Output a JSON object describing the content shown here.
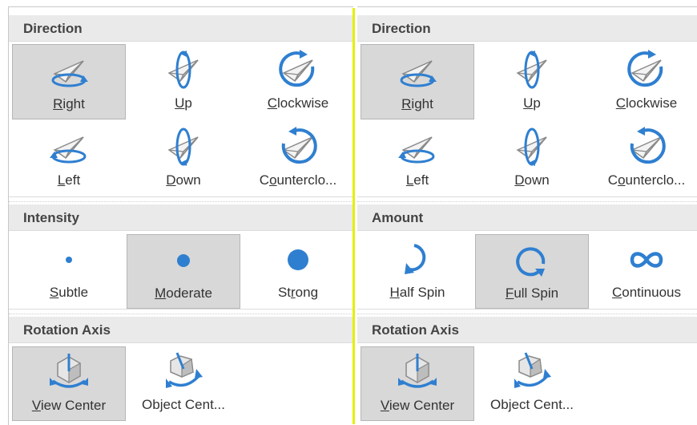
{
  "colors": {
    "icon_blue": "#2f7fd0",
    "icon_gray": "#8a8a8a",
    "divider": "#e6f000"
  },
  "left_panel": {
    "direction": {
      "header": "Direction",
      "items": [
        {
          "label": "Right",
          "mnemonic": "R",
          "rest": "ight",
          "icon": "plane-orbit-right-icon",
          "selected": true
        },
        {
          "label": "Up",
          "mnemonic": "U",
          "rest": "p",
          "icon": "plane-orbit-up-icon",
          "selected": false
        },
        {
          "label": "Clockwise",
          "mnemonic": "C",
          "rest": "lockwise",
          "icon": "plane-clockwise-icon",
          "selected": false
        },
        {
          "label": "Left",
          "mnemonic": "L",
          "rest": "eft",
          "icon": "plane-orbit-left-icon",
          "selected": false
        },
        {
          "label": "Down",
          "mnemonic": "D",
          "rest": "own",
          "icon": "plane-orbit-down-icon",
          "selected": false
        },
        {
          "label": "Counterclo...",
          "mnemonic": "o",
          "pre": "C",
          "rest": "unterclo...",
          "icon": "plane-counterclockwise-icon",
          "selected": false
        }
      ]
    },
    "intensity": {
      "header": "Intensity",
      "items": [
        {
          "label": "Subtle",
          "mnemonic": "S",
          "rest": "ubtle",
          "icon": "dot-small-icon",
          "selected": false
        },
        {
          "label": "Moderate",
          "mnemonic": "M",
          "rest": "oderate",
          "icon": "dot-medium-icon",
          "selected": true
        },
        {
          "label": "Strong",
          "pre": "St",
          "mnemonic": "r",
          "rest": "ong",
          "icon": "dot-large-icon",
          "selected": false
        }
      ]
    },
    "rotation_axis": {
      "header": "Rotation Axis",
      "items": [
        {
          "label": "View Center",
          "mnemonic": "V",
          "rest": "iew Center",
          "icon": "cube-view-center-icon",
          "selected": true
        },
        {
          "label": "Object Cent...",
          "mnemonic": "",
          "rest": "Object Cent...",
          "icon": "cube-object-center-icon",
          "selected": false
        }
      ]
    }
  },
  "right_panel": {
    "direction": {
      "header": "Direction",
      "items": [
        {
          "label": "Right",
          "mnemonic": "R",
          "rest": "ight",
          "icon": "plane-orbit-right-icon",
          "selected": true
        },
        {
          "label": "Up",
          "mnemonic": "U",
          "rest": "p",
          "icon": "plane-orbit-up-icon",
          "selected": false
        },
        {
          "label": "Clockwise",
          "mnemonic": "C",
          "rest": "lockwise",
          "icon": "plane-clockwise-icon",
          "selected": false
        },
        {
          "label": "Left",
          "mnemonic": "L",
          "rest": "eft",
          "icon": "plane-orbit-left-icon",
          "selected": false
        },
        {
          "label": "Down",
          "mnemonic": "D",
          "rest": "own",
          "icon": "plane-orbit-down-icon",
          "selected": false
        },
        {
          "label": "Counterclo...",
          "mnemonic": "o",
          "pre": "C",
          "rest": "unterclo...",
          "icon": "plane-counterclockwise-icon",
          "selected": false
        }
      ]
    },
    "amount": {
      "header": "Amount",
      "items": [
        {
          "label": "Half Spin",
          "mnemonic": "H",
          "rest": "alf Spin",
          "icon": "half-spin-arrow-icon",
          "selected": false
        },
        {
          "label": "Full Spin",
          "mnemonic": "F",
          "rest": "ull Spin",
          "icon": "full-spin-arrow-icon",
          "selected": true
        },
        {
          "label": "Continuous",
          "mnemonic": "C",
          "rest": "ontinuous",
          "icon": "infinity-icon",
          "selected": false
        }
      ]
    },
    "rotation_axis": {
      "header": "Rotation Axis",
      "items": [
        {
          "label": "View Center",
          "mnemonic": "V",
          "rest": "iew Center",
          "icon": "cube-view-center-icon",
          "selected": true
        },
        {
          "label": "Object Cent...",
          "mnemonic": "",
          "rest": "Object Cent...",
          "icon": "cube-object-center-icon",
          "selected": false
        }
      ]
    }
  }
}
